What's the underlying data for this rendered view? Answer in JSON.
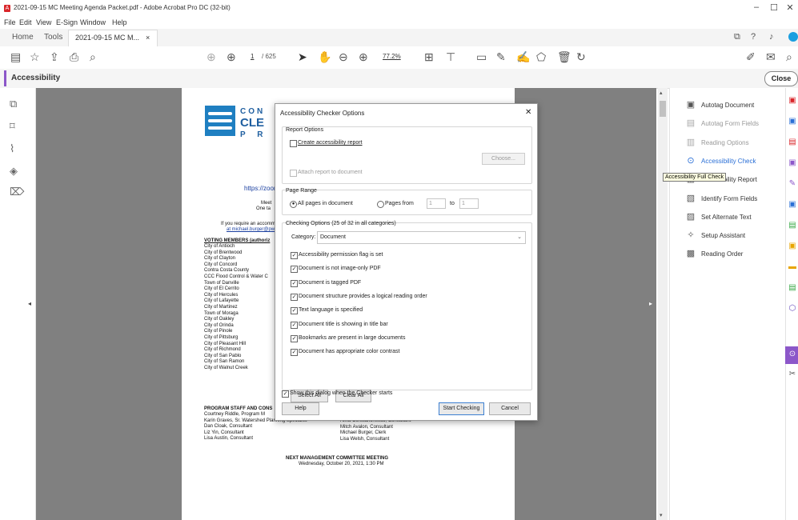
{
  "window": {
    "title": "2021-09-15 MC Meeting Agenda Packet.pdf - Adobe Acrobat Pro DC (32-bit)",
    "minimize": "–",
    "maximize": "☐",
    "close": "✕"
  },
  "menubar": [
    "File",
    "Edit",
    "View",
    "E-Sign",
    "Window",
    "Help"
  ],
  "tabs": {
    "home": "Home",
    "tools": "Tools",
    "doc": "2021-09-15 MC M...",
    "doc_close": "×"
  },
  "toolbar": {
    "page_current": "1",
    "page_total": "/ 625",
    "zoom": "77.2%"
  },
  "accessibility_bar": {
    "title": "Accessibility",
    "close": "Close"
  },
  "page": {
    "org_line1": "CON",
    "org_line2": "CLE",
    "org_line3": "P R",
    "zoom_link": "https://zoom",
    "meet": "Meet",
    "one_tap": "One ta",
    "accom1": "If you require an accomm",
    "accom2": "at michael.burger@pw.c",
    "voting_header": "VOTING MEMBERS (authoriz",
    "members": [
      "City of Antioch",
      "City of Brentwood",
      "City of Clayton",
      "City of Concord",
      "Contra Costa County",
      "CCC Flood Control & Water C",
      "Town of Danville",
      "City of El Cerrito",
      "City of Hercules",
      "City of Lafayette",
      "City of Martinez",
      "Town of Moraga",
      "City of Oakley",
      "City of Orinda",
      "City of Pinole",
      "City of Pittsburg",
      "City of Pleasant Hill",
      "City of Richmond",
      "City of San Pablo",
      "City of San Ramon",
      "City of Walnut Creek"
    ],
    "staff_header": "PROGRAM STAFF AND CONS",
    "staff_left": [
      "Courtney Riddle, Program M",
      "Karin Graves, Sr. Watershed Planning Specialist",
      "Dan Cloak, Consultant",
      "Liz Yin, Consultant",
      "Lisa Austin, Consultant"
    ],
    "staff_right": [
      "Alina Constantinescu, Consultant",
      "Mitch Avalon, Consultant",
      "Michael Burger, Clerk",
      "Lisa Welsh, Consultant"
    ],
    "next_meeting": "NEXT MANAGEMENT COMMITTEE MEETING",
    "next_date": "Wednesday, October 20, 2021, 1:30 PM"
  },
  "dialog": {
    "title": "Accessibility Checker Options",
    "close": "✕",
    "report_options": "Report Options",
    "create_report": "Create accessibility report",
    "choose": "Choose...",
    "attach_report": "Attach report to document",
    "page_range": "Page Range",
    "all_pages": "All pages in document",
    "pages_from": "Pages from",
    "from_value": "1",
    "to_label": "to",
    "to_value": "1",
    "checking_options": "Checking Options (25 of 32 in all categories)",
    "category_label": "Category:",
    "category_value": "Document",
    "checks": [
      "Accessibility permission flag is set",
      "Document is not image-only PDF",
      "Document is tagged PDF",
      "Document structure provides a logical reading order",
      "Text language is specified",
      "Document title is showing in title bar",
      "Bookmarks are present in large documents",
      "Document has appropriate color contrast"
    ],
    "select_all": "Select All",
    "clear_all": "Clear All",
    "show_dialog": "Show this dialog when the Checker starts",
    "help": "Help",
    "start": "Start Checking",
    "cancel": "Cancel"
  },
  "right_panel": {
    "items": [
      "Autotag Document",
      "Autotag Form Fields",
      "Reading Options",
      "Accessibility Check",
      "Accessibility Report",
      "Identify Form Fields",
      "Set Alternate Text",
      "Setup Assistant",
      "Reading Order"
    ],
    "tooltip": "Accessibility Full Check",
    "accent": "#8c57c9"
  }
}
